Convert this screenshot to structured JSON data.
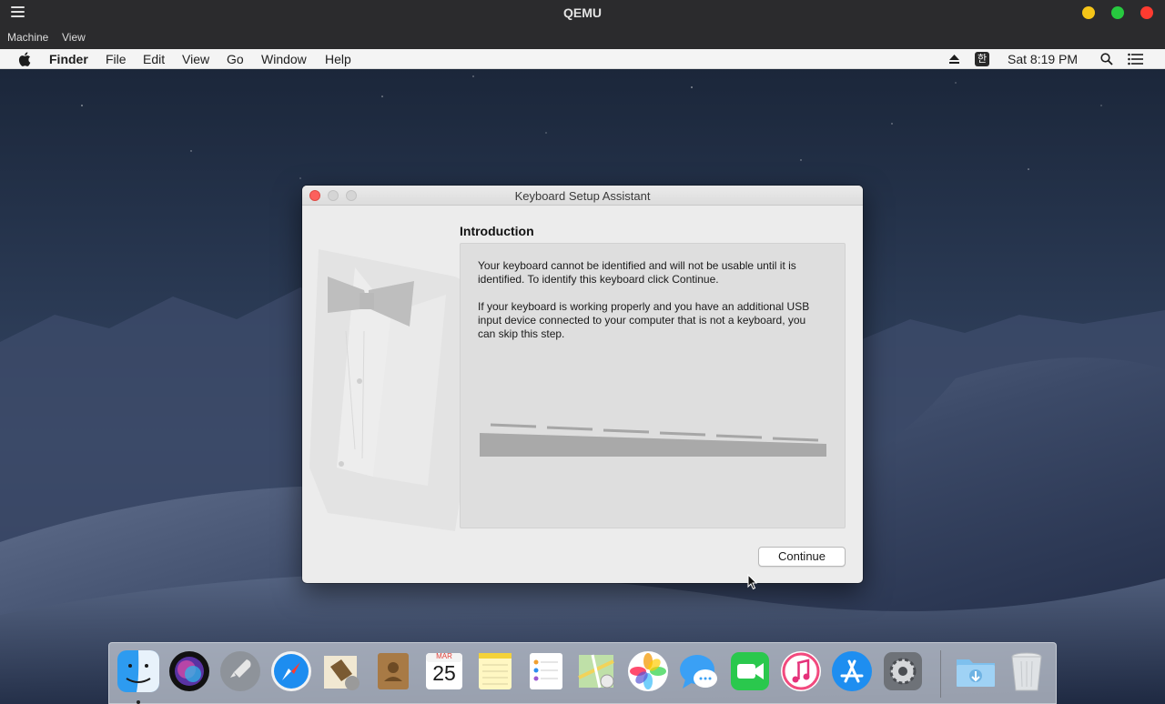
{
  "qemu": {
    "title": "QEMU",
    "menu": [
      "Machine",
      "View"
    ],
    "colors": {
      "minimize": "#f5c518",
      "maximize": "#27c93f",
      "close": "#ff3b30"
    }
  },
  "mac_menubar": {
    "apple": "",
    "app_name": "Finder",
    "items": [
      "File",
      "Edit",
      "View",
      "Go",
      "Window",
      "Help"
    ],
    "input_source": "한",
    "clock": "Sat 8:19 PM"
  },
  "dialog": {
    "title": "Keyboard Setup Assistant",
    "section_title": "Introduction",
    "paragraph1": "Your keyboard cannot be identified and will not be usable until it is identified. To identify this keyboard click Continue.",
    "paragraph2": "If your keyboard is working properly and you have an additional USB input device connected to your computer that is not a keyboard, you can skip this step.",
    "continue_label": "Continue"
  },
  "dock": {
    "apps": [
      "finder-icon",
      "siri-icon",
      "launchpad-icon",
      "safari-icon",
      "mail-icon",
      "contacts-icon",
      "calendar-icon",
      "notes-icon",
      "reminders-icon",
      "maps-icon",
      "photos-icon",
      "messages-icon",
      "facetime-icon",
      "itunes-icon",
      "app-store-icon",
      "system-preferences-icon",
      "downloads-folder-icon",
      "trash-icon"
    ],
    "calendar": {
      "month": "MAR",
      "day": "25"
    }
  }
}
